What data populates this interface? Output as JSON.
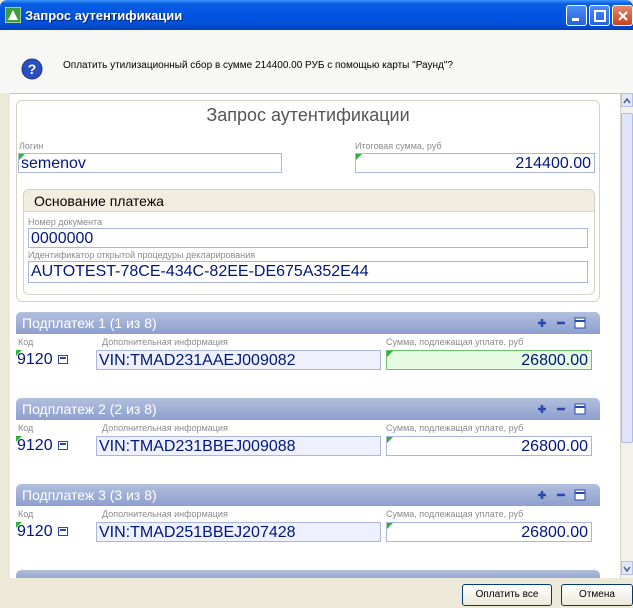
{
  "window": {
    "title": "Запрос аутентификации"
  },
  "question": {
    "text": "Оплатить утилизационный сбор в сумме 214400.00 РУБ с помощью карты \"Раунд\"?"
  },
  "auth": {
    "title": "Запрос аутентификации",
    "login_label": "Логин",
    "login_value": "semenov",
    "total_label": "Итоговая сумма, руб",
    "total_value": "214400.00"
  },
  "basis": {
    "title": "Основание платежа",
    "doc_label": "Номер документа",
    "doc_value": "0000000",
    "proc_label": "Идентификатор открытой процедуры декларирования",
    "proc_value": "AUTOTEST-78CE-434C-82EE-DE675A352E44"
  },
  "subpayments": [
    {
      "title": "Подплатеж 1 (1 из 8)",
      "code_label": "Код",
      "info_label": "Дополнительная информация",
      "sum_label": "Сумма, подлежащая уплате, руб",
      "code": "9120",
      "info": "VIN:TMAD231AAEJ009082",
      "sum": "26800.00"
    },
    {
      "title": "Подплатеж 2 (2 из 8)",
      "code_label": "Код",
      "info_label": "Дополнительная информация",
      "sum_label": "Сумма, подлежащая уплате, руб",
      "code": "9120",
      "info": "VIN:TMAD231BBEJ009088",
      "sum": "26800.00"
    },
    {
      "title": "Подплатеж 3 (3 из 8)",
      "code_label": "Код",
      "info_label": "Дополнительная информация",
      "sum_label": "Сумма, подлежащая уплате, руб",
      "code": "9120",
      "info": "VIN:TMAD251BBEJ207428",
      "sum": "26800.00"
    }
  ],
  "buttons": {
    "pay_all": "Оплатить все",
    "cancel": "Отмена"
  },
  "colors": {
    "title_bar": "#0054e3",
    "field_text": "#00177c",
    "sub_header": "#8d9fcf",
    "active_field": "#e6fbe2"
  },
  "icons": [
    "app-icon",
    "minimize-icon",
    "maximize-icon",
    "close-icon",
    "question-icon",
    "add-icon",
    "remove-icon",
    "list-icon",
    "lookup-icon"
  ]
}
